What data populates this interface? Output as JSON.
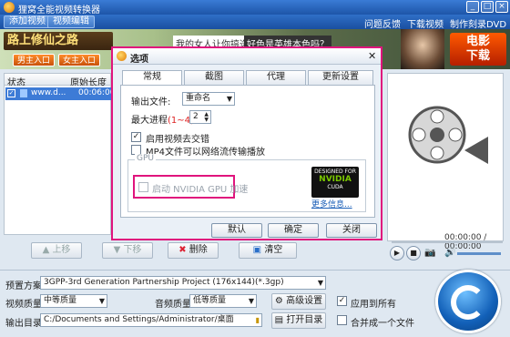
{
  "window": {
    "title": "狸窝全能视频转换器",
    "controls": [
      "_",
      "□",
      "×"
    ]
  },
  "menubar": {
    "buttons": [
      "添加视频",
      "视频编辑"
    ],
    "links": [
      "问题反馈",
      "下载视频",
      "制作刻录DVD"
    ]
  },
  "banner": {
    "title": "路上修仙之路",
    "btn1": "男主入口",
    "btn2": "女主入口",
    "text1": "我的女人让你搞选！",
    "text2": "好色是英雄本色吗？",
    "logo1": "电影",
    "logo2": "下载"
  },
  "file_list": {
    "columns": [
      "状态",
      "原始长度"
    ],
    "rows": [
      {
        "name": "www.d...",
        "duration": "00:06:00"
      }
    ]
  },
  "preview": {
    "timecode": "00:00:00 / 00:00:00"
  },
  "toolbar": {
    "up": "上移",
    "down": "下移",
    "delete": "删除",
    "clear": "清空"
  },
  "bottom": {
    "preset_label": "预置方案:",
    "preset_value": "3GPP-3rd Generation Partnership Project (176x144)(*.3gp)",
    "video_quality_label": "视频质量:",
    "video_quality_value": "中等质量",
    "audio_quality_label": "音频质量:",
    "audio_quality_value": "低等质量",
    "advanced": "高级设置",
    "apply_all": "应用到所有",
    "output_label": "输出目录:",
    "output_value": "C:/Documents and Settings/Administrator/桌面",
    "open_dir": "打开目录",
    "merge": "合并成一个文件"
  },
  "dialog": {
    "title": "选项",
    "tabs": [
      "常规",
      "截图",
      "代理",
      "更新设置"
    ],
    "output_file_label": "输出文件:",
    "output_file_value": "重命名",
    "max_process_label": "最大进程",
    "max_process_hint": "(1~4):",
    "max_process_value": "2",
    "deinterlace": "启用视频去交错",
    "mp4_stream": "MP4文件可以网络流传输播放",
    "gpu_group": "GPU",
    "gpu_enable": "启动 NVIDIA GPU 加速",
    "nvidia_line1": "DESIGNED FOR",
    "nvidia_line2": "NVIDIA",
    "nvidia_line3": "CUDA",
    "more_info": "更多信息...",
    "buttons": [
      "默认",
      "确定",
      "关闭"
    ]
  }
}
